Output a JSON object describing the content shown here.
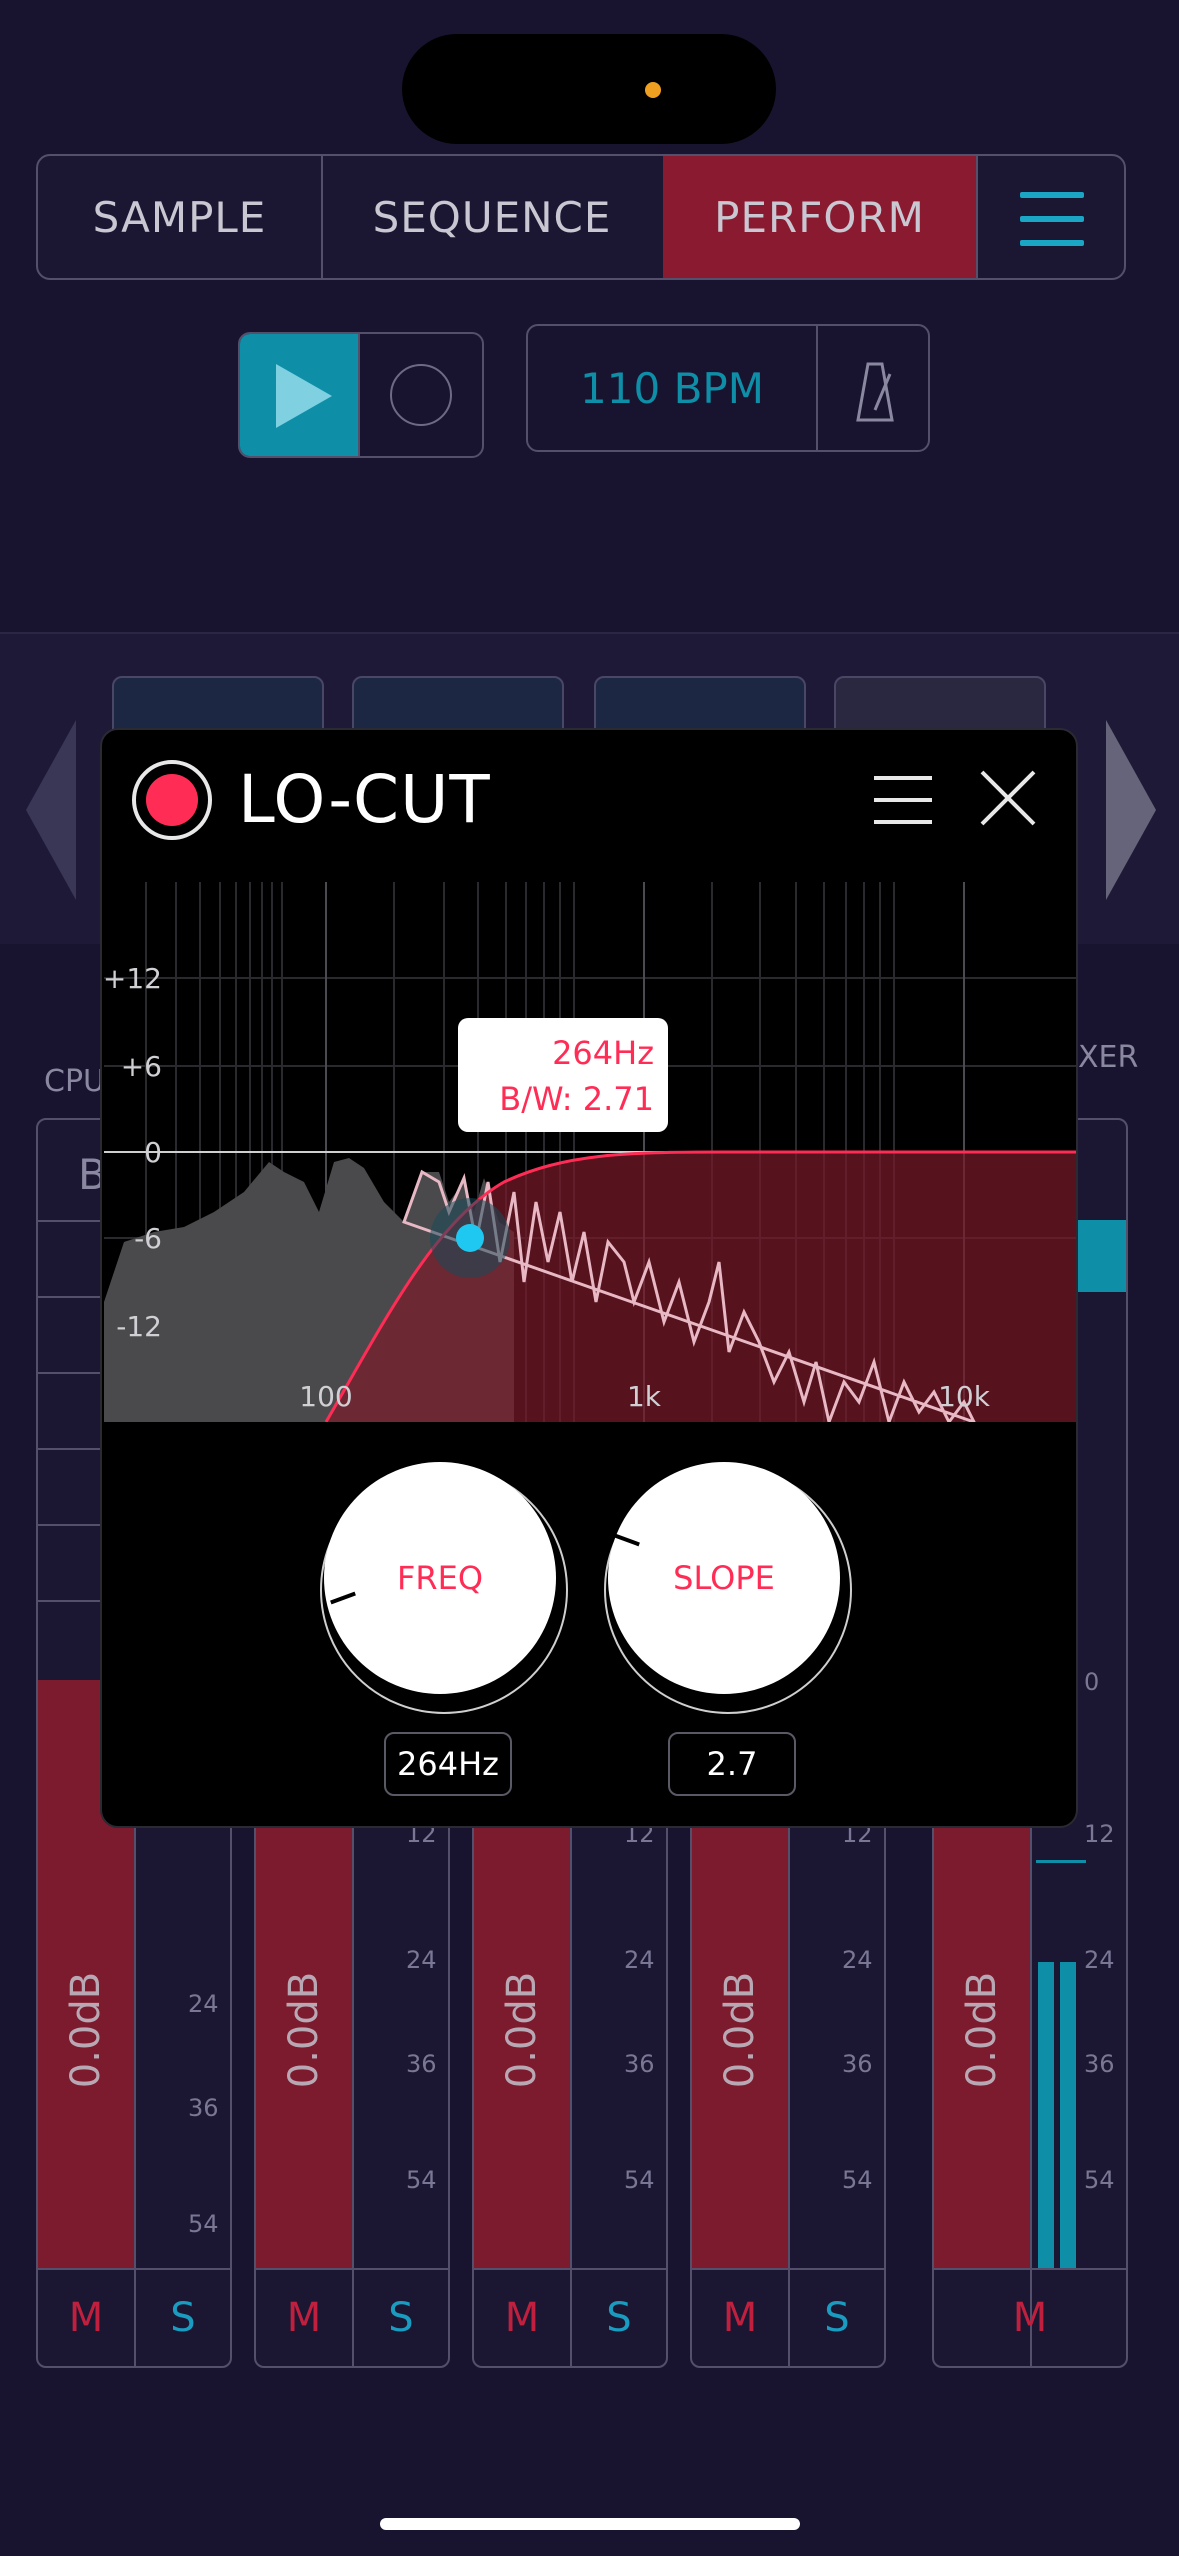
{
  "nav": {
    "tabs": [
      {
        "label": "SAMPLE"
      },
      {
        "label": "SEQUENCE"
      },
      {
        "label": "PERFORM"
      }
    ],
    "menu_icon": "hamburger-icon"
  },
  "transport": {
    "play_icon": "play-icon",
    "record_icon": "record-icon",
    "bpm_label": "110 BPM",
    "metronome_icon": "metronome-icon"
  },
  "side_labels": {
    "left": "CPU",
    "right": "XER",
    "left_cell": "B"
  },
  "mixer": {
    "channels": [
      {
        "db": "0.0dB",
        "mute": "M",
        "solo": "S"
      },
      {
        "db": "0.0dB",
        "mute": "M",
        "solo": "S"
      },
      {
        "db": "0.0dB",
        "mute": "M",
        "solo": "S"
      },
      {
        "db": "0.0dB",
        "mute": "M",
        "solo": "S"
      },
      {
        "db": "0.0dB",
        "mute": "M"
      }
    ],
    "scale": [
      "12",
      "24",
      "36",
      "54"
    ],
    "master_scale": [
      "0",
      "12",
      "24",
      "36",
      "54"
    ]
  },
  "popup": {
    "title": "LO-CUT",
    "power_icon": "power-icon",
    "menu_icon": "menu-icon",
    "close_icon": "close-icon",
    "graph": {
      "y_labels": [
        "+12",
        "+6",
        "0",
        "-6",
        "-12"
      ],
      "x_labels": [
        "100",
        "1k",
        "10k"
      ]
    },
    "tooltip": {
      "freq": "264Hz",
      "bw": "B/W: 2.71"
    },
    "knobs": [
      {
        "label": "FREQ",
        "value": "264Hz"
      },
      {
        "label": "SLOPE",
        "value": "2.7"
      }
    ]
  },
  "colors": {
    "accent_red": "#ff2d55",
    "accent_blue": "#0f8ea8",
    "background": "#181430"
  }
}
